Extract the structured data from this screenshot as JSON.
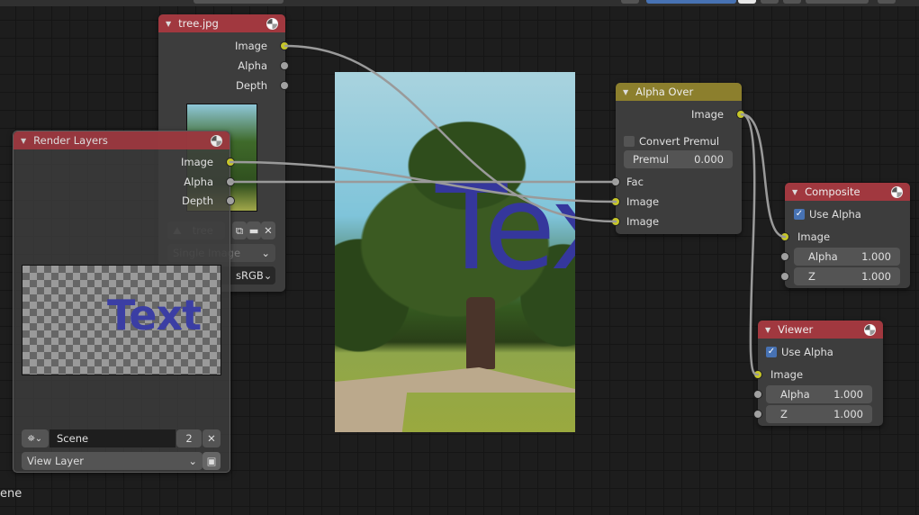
{
  "editor": {
    "partial_label": "ene"
  },
  "nodes": {
    "image_node": {
      "title": "tree.jpg",
      "outputs": [
        "Image",
        "Alpha",
        "Depth"
      ],
      "image_name": "tree",
      "source": "Single Image",
      "color_space": "sRGB"
    },
    "render_layers": {
      "title": "Render Layers",
      "outputs": [
        "Image",
        "Alpha",
        "Depth"
      ],
      "preview_text": "Text",
      "scene": "Scene",
      "scene_users": "2",
      "view_layer": "View Layer"
    },
    "alpha_over": {
      "title": "Alpha Over",
      "output": "Image",
      "convert_premul_label": "Convert Premul",
      "convert_premul_checked": false,
      "premul_label": "Premul",
      "premul_value": "0.000",
      "inputs": [
        "Fac",
        "Image",
        "Image"
      ]
    },
    "composite": {
      "title": "Composite",
      "use_alpha_label": "Use Alpha",
      "use_alpha_checked": true,
      "input_image": "Image",
      "alpha_label": "Alpha",
      "alpha_value": "1.000",
      "z_label": "Z",
      "z_value": "1.000"
    },
    "viewer": {
      "title": "Viewer",
      "use_alpha_label": "Use Alpha",
      "use_alpha_checked": true,
      "input_image": "Image",
      "alpha_label": "Alpha",
      "alpha_value": "1.000",
      "z_label": "Z",
      "z_value": "1.000"
    }
  },
  "backdrop": {
    "overlay_text": "Tex"
  },
  "colors": {
    "image_socket": "#c7c729",
    "value_socket": "#a1a1a1",
    "output_node_header": "#a1383f",
    "color_node_header": "#8c7f2d",
    "accent": "#4772b3"
  }
}
